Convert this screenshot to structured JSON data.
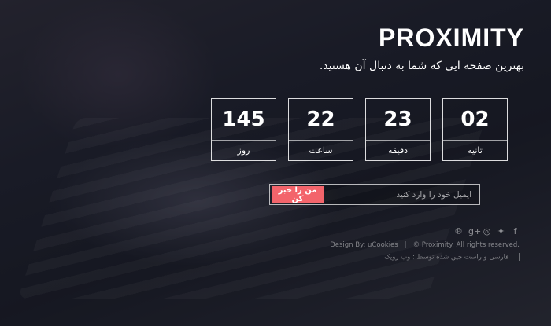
{
  "brand": {
    "title": "PROXIMITY",
    "tagline": "بهترین صفحه ایی که شما به دنبال آن هستید."
  },
  "countdown": [
    {
      "value": "145",
      "unit": "روز"
    },
    {
      "value": "22",
      "unit": "ساعت"
    },
    {
      "value": "23",
      "unit": "دقیقه"
    },
    {
      "value": "02",
      "unit": "ثانیه"
    }
  ],
  "subscribe": {
    "placeholder": "ایمیل خود را وارد کنید",
    "button_label": "من را خبر کن"
  },
  "social": [
    {
      "icon": "pinterest-icon",
      "glyph": "℗"
    },
    {
      "icon": "google-plus-icon",
      "glyph": "g+"
    },
    {
      "icon": "dribbble-icon",
      "glyph": "◎"
    },
    {
      "icon": "twitter-icon",
      "glyph": "✦"
    },
    {
      "icon": "facebook-icon",
      "glyph": "f"
    }
  ],
  "footer": {
    "design_by": "Design By: uCookies",
    "copyright": "© Proximity. All rights reserved.",
    "localized": "فارسی و راست چین شده توسط : وب رویک"
  },
  "colors": {
    "accent": "#f3646b",
    "text": "#ffffff"
  }
}
